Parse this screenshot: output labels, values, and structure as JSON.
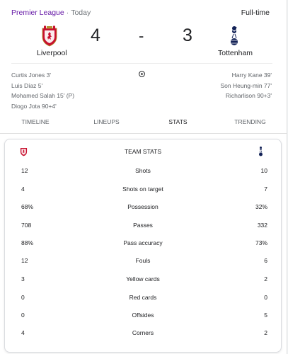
{
  "match": {
    "league": "Premier League",
    "separator": "·",
    "date": "Today",
    "status": "Full-time",
    "home_team": "Liverpool",
    "away_team": "Tottenham",
    "home_score": "4",
    "away_score": "3",
    "score_separator": "-"
  },
  "scorers": {
    "home": [
      "Curtis Jones 3'",
      "Luis Díaz 5'",
      "Mohamed Salah 15' (P)",
      "Diogo Jota 90+4'"
    ],
    "away": [
      "Harry Kane 39'",
      "Son Heung-min 77'",
      "Richarlison 90+3'"
    ]
  },
  "tabs": [
    {
      "label": "TIMELINE",
      "active": false
    },
    {
      "label": "LINEUPS",
      "active": false
    },
    {
      "label": "STATS",
      "active": true
    },
    {
      "label": "TRENDING",
      "active": false
    }
  ],
  "stats": {
    "title": "TEAM STATS",
    "rows": [
      {
        "home": "12",
        "label": "Shots",
        "away": "10"
      },
      {
        "home": "4",
        "label": "Shots on target",
        "away": "7"
      },
      {
        "home": "68%",
        "label": "Possession",
        "away": "32%"
      },
      {
        "home": "708",
        "label": "Passes",
        "away": "332"
      },
      {
        "home": "88%",
        "label": "Pass accuracy",
        "away": "73%"
      },
      {
        "home": "12",
        "label": "Fouls",
        "away": "6"
      },
      {
        "home": "3",
        "label": "Yellow cards",
        "away": "2"
      },
      {
        "home": "0",
        "label": "Red cards",
        "away": "0"
      },
      {
        "home": "0",
        "label": "Offsides",
        "away": "5"
      },
      {
        "home": "4",
        "label": "Corners",
        "away": "2"
      }
    ]
  },
  "icons": {
    "home_crest": "liverpool-crest-icon",
    "away_crest": "tottenham-crest-icon",
    "goal": "soccer-ball-icon"
  },
  "colors": {
    "league": "#681da8",
    "liverpool_red": "#c8102e",
    "tottenham_navy": "#132257"
  }
}
